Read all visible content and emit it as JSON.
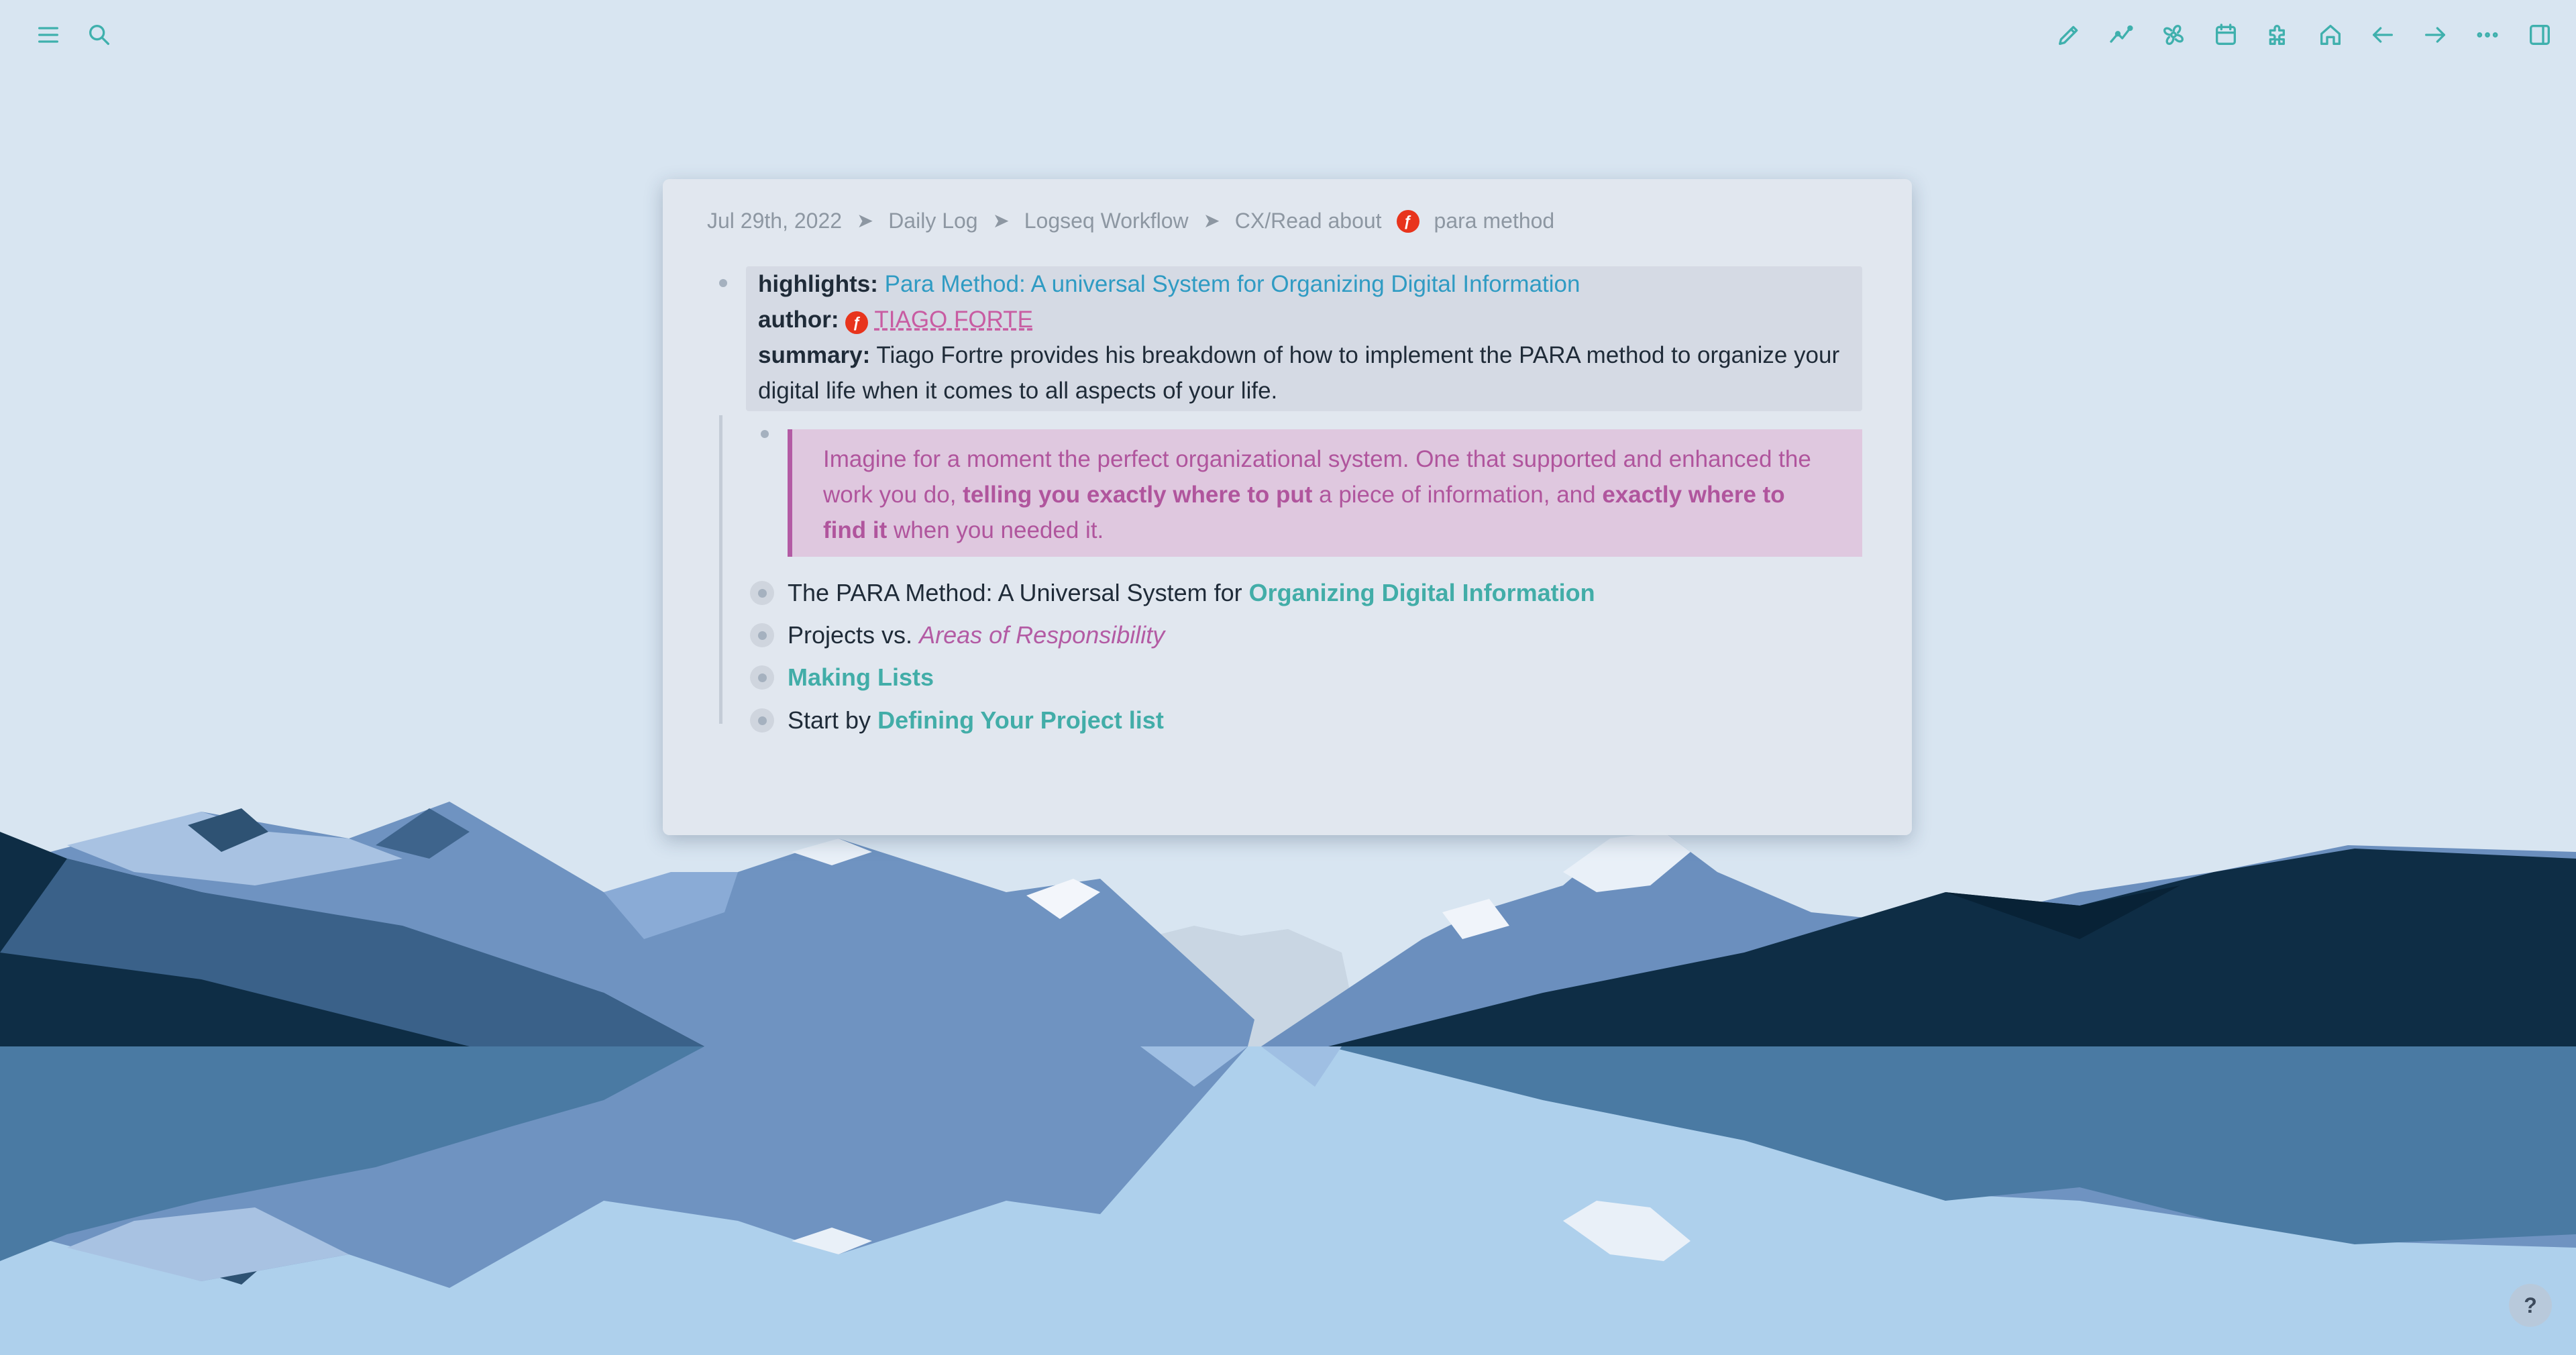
{
  "breadcrumb": {
    "items": [
      "Jul 29th, 2022",
      "Daily Log",
      "Logseq Workflow",
      "CX/Read about",
      "para method"
    ]
  },
  "properties": {
    "highlights_key": "highlights:",
    "highlights_value": "Para Method: A universal System for Organizing Digital Information",
    "author_key": "author:",
    "author_value": "TIAGO FORTE",
    "summary_key": "summary:",
    "summary_value": "Tiago Fortre provides his breakdown of how to implement the PARA method to organize your digital life when it comes to all aspects of your life."
  },
  "quote": {
    "part1": "Imagine for a moment the perfect organizational system. One that supported and enhanced the work you do,",
    "bold1": "telling you exactly where to put",
    "part2": "a piece of information, and",
    "bold2": "exactly where to find it",
    "part3": "when you needed it."
  },
  "items": [
    {
      "plain": "The PARA Method: A Universal System for",
      "link": "Organizing Digital Information"
    },
    {
      "plain": "Projects vs.",
      "link": "Areas of Responsibility"
    },
    {
      "plain": "",
      "link": "Making Lists"
    },
    {
      "plain": "Start by",
      "link": "Defining Your Project list"
    }
  ],
  "icons": {
    "left": [
      "menu-icon",
      "search-icon"
    ],
    "right": [
      "pen-icon",
      "graph-icon",
      "flashcards-icon",
      "calendar-icon",
      "plugins-icon",
      "home-icon",
      "back-icon",
      "forward-icon",
      "more-icon",
      "sidebar-icon"
    ]
  },
  "help_label": "?",
  "colors": {
    "accent": "#3fb0ad",
    "link_blue": "#2f9bc3",
    "pink": "#b35ba4",
    "background": "#d8e5f1"
  }
}
